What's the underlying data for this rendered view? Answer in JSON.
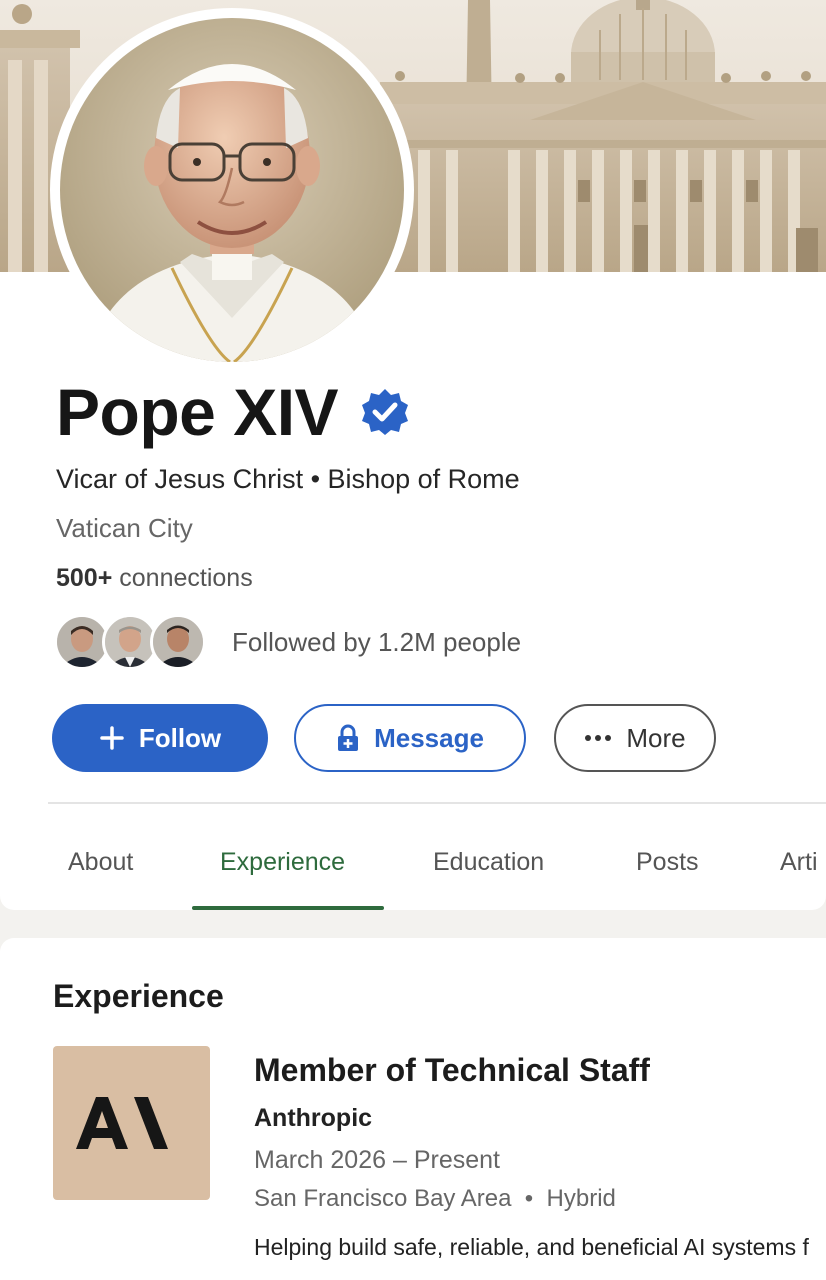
{
  "profile": {
    "name": "Pope XIV",
    "headline": "Vicar of Jesus Christ • Bishop of Rome",
    "location": "Vatican City",
    "connections_count": "500+",
    "connections_label": "connections",
    "followed_by": "Followed by 1.2M people"
  },
  "actions": {
    "follow_label": "Follow",
    "message_label": "Message",
    "more_label": "More"
  },
  "tabs": [
    {
      "label": "About",
      "active": false
    },
    {
      "label": "Experience",
      "active": true
    },
    {
      "label": "Education",
      "active": false
    },
    {
      "label": "Posts",
      "active": false
    },
    {
      "label": "Arti",
      "active": false
    }
  ],
  "experience": {
    "section_title": "Experience",
    "items": [
      {
        "logo_text": "AI",
        "title": "Member of Technical Staff",
        "company": "Anthropic",
        "dates": "March 2026 – Present",
        "location": "San Francisco Bay Area",
        "work_type": "Hybrid",
        "description": "Helping build safe, reliable, and beneficial AI systems f"
      }
    ]
  },
  "colors": {
    "accent": "#2b63c6",
    "tab_active": "#2e6b3d",
    "logo_bg": "#d9bea3"
  },
  "icons": [
    "verified-badge-icon",
    "plus-icon",
    "lock-icon",
    "ellipsis-icon"
  ]
}
